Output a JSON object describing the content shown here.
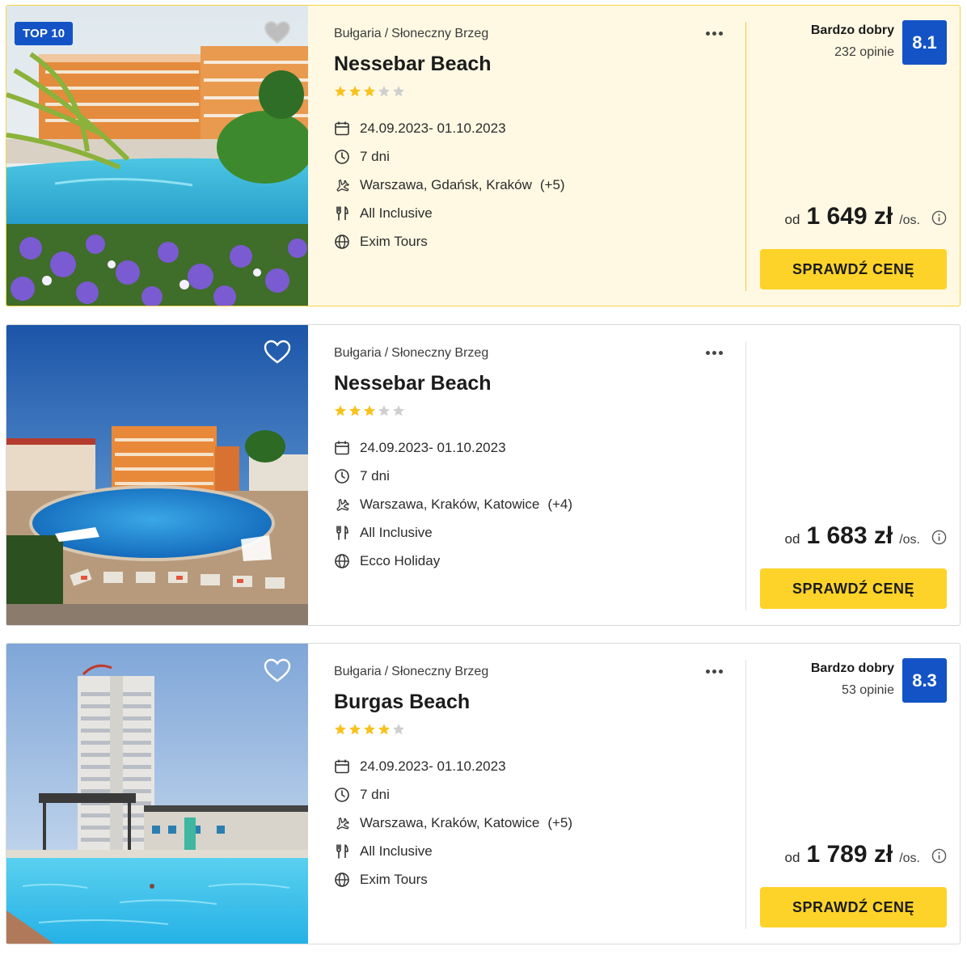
{
  "colors": {
    "accent_blue": "#1353c6",
    "cta_yellow": "#fdd329",
    "highlight_bg": "#fff9e3",
    "star_filled": "#f7c21e",
    "star_empty": "#cfcfcf"
  },
  "offers": [
    {
      "badge": "TOP 10",
      "favorited": false,
      "breadcrumb": {
        "country": "Bułgaria",
        "separator": "/",
        "region": "Słoneczny Brzeg"
      },
      "name": "Nessebar Beach",
      "stars_filled": 3,
      "stars_total": 5,
      "dates": "24.09.2023- 01.10.2023",
      "duration": "7 dni",
      "departures": "Warszawa, Gdańsk, Kraków",
      "departures_more": "(+5)",
      "board": "All Inclusive",
      "operator": "Exim Tours",
      "rating": {
        "label": "Bardzo dobry",
        "reviews": "232 opinie",
        "score": "8.1"
      },
      "price": {
        "prefix": "od",
        "amount": "1 649 zł",
        "suffix": "/os."
      },
      "cta": "SPRAWDŹ CENĘ"
    },
    {
      "badge": "",
      "favorited": false,
      "breadcrumb": {
        "country": "Bułgaria",
        "separator": "/",
        "region": "Słoneczny Brzeg"
      },
      "name": "Nessebar Beach",
      "stars_filled": 3,
      "stars_total": 5,
      "dates": "24.09.2023- 01.10.2023",
      "duration": "7 dni",
      "departures": "Warszawa, Kraków, Katowice",
      "departures_more": "(+4)",
      "board": "All Inclusive",
      "operator": "Ecco Holiday",
      "rating": null,
      "price": {
        "prefix": "od",
        "amount": "1 683 zł",
        "suffix": "/os."
      },
      "cta": "SPRAWDŹ CENĘ"
    },
    {
      "badge": "",
      "favorited": false,
      "breadcrumb": {
        "country": "Bułgaria",
        "separator": "/",
        "region": "Słoneczny Brzeg"
      },
      "name": "Burgas Beach",
      "stars_filled": 4,
      "stars_total": 5,
      "dates": "24.09.2023- 01.10.2023",
      "duration": "7 dni",
      "departures": "Warszawa, Kraków, Katowice",
      "departures_more": "(+5)",
      "board": "All Inclusive",
      "operator": "Exim Tours",
      "rating": {
        "label": "Bardzo dobry",
        "reviews": "53 opinie",
        "score": "8.3"
      },
      "price": {
        "prefix": "od",
        "amount": "1 789 zł",
        "suffix": "/os."
      },
      "cta": "SPRAWDŹ CENĘ"
    }
  ]
}
